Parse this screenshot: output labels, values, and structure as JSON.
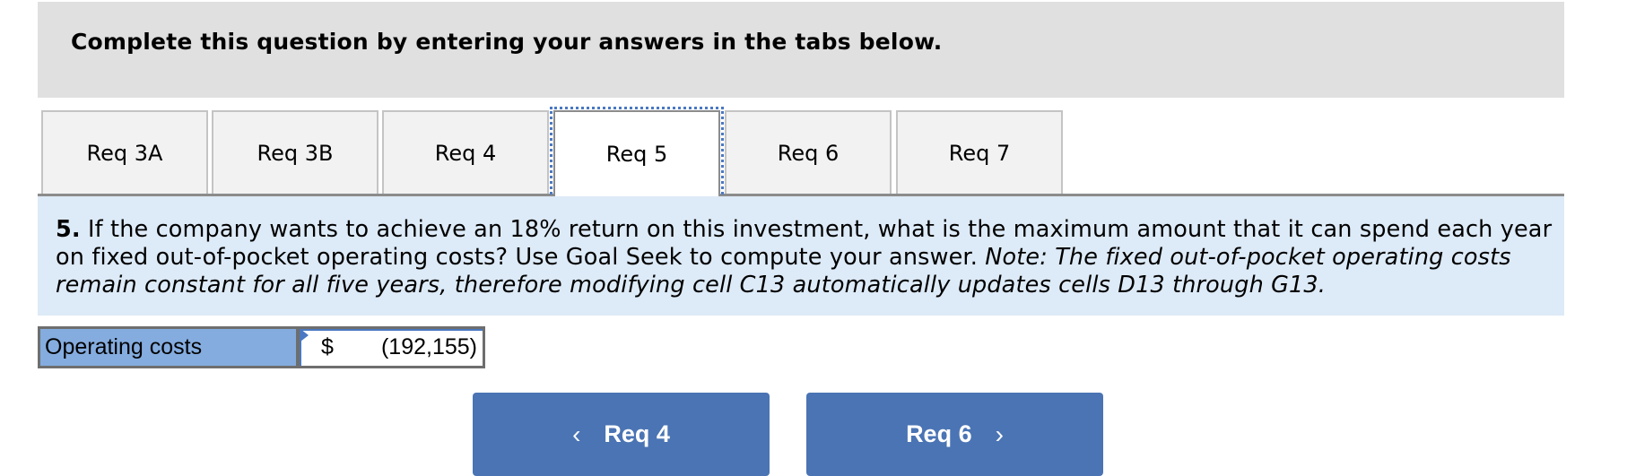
{
  "banner": {
    "text": "Complete this question by entering your answers in the tabs below."
  },
  "tabs": [
    {
      "label": "Req 3A",
      "active": false
    },
    {
      "label": "Req 3B",
      "active": false
    },
    {
      "label": "Req 4",
      "active": false
    },
    {
      "label": "Req 5",
      "active": true
    },
    {
      "label": "Req 6",
      "active": false
    },
    {
      "label": "Req 7",
      "active": false
    }
  ],
  "question": {
    "number": "5.",
    "text": " If the company wants to achieve an 18% return on this investment, what is the maximum amount that it can spend each year on fixed out-of-pocket operating costs? Use Goal Seek to compute your answer. ",
    "note": "Note: The fixed out-of-pocket operating costs remain constant for all five years, therefore modifying cell C13 automatically updates cells D13 through G13."
  },
  "answer_row": {
    "label": "Operating costs",
    "currency": "$",
    "value": "(192,155)"
  },
  "navigation": {
    "prev_label": "Req 4",
    "prev_icon": "‹",
    "next_label": "Req 6",
    "next_icon": "›"
  },
  "colors": {
    "banner_bg": "#e0e0e0",
    "question_bg": "#ddeaf7",
    "label_bg": "#84acdf",
    "button_bg": "#4a74b4",
    "focus_outline": "#4a78c2"
  }
}
